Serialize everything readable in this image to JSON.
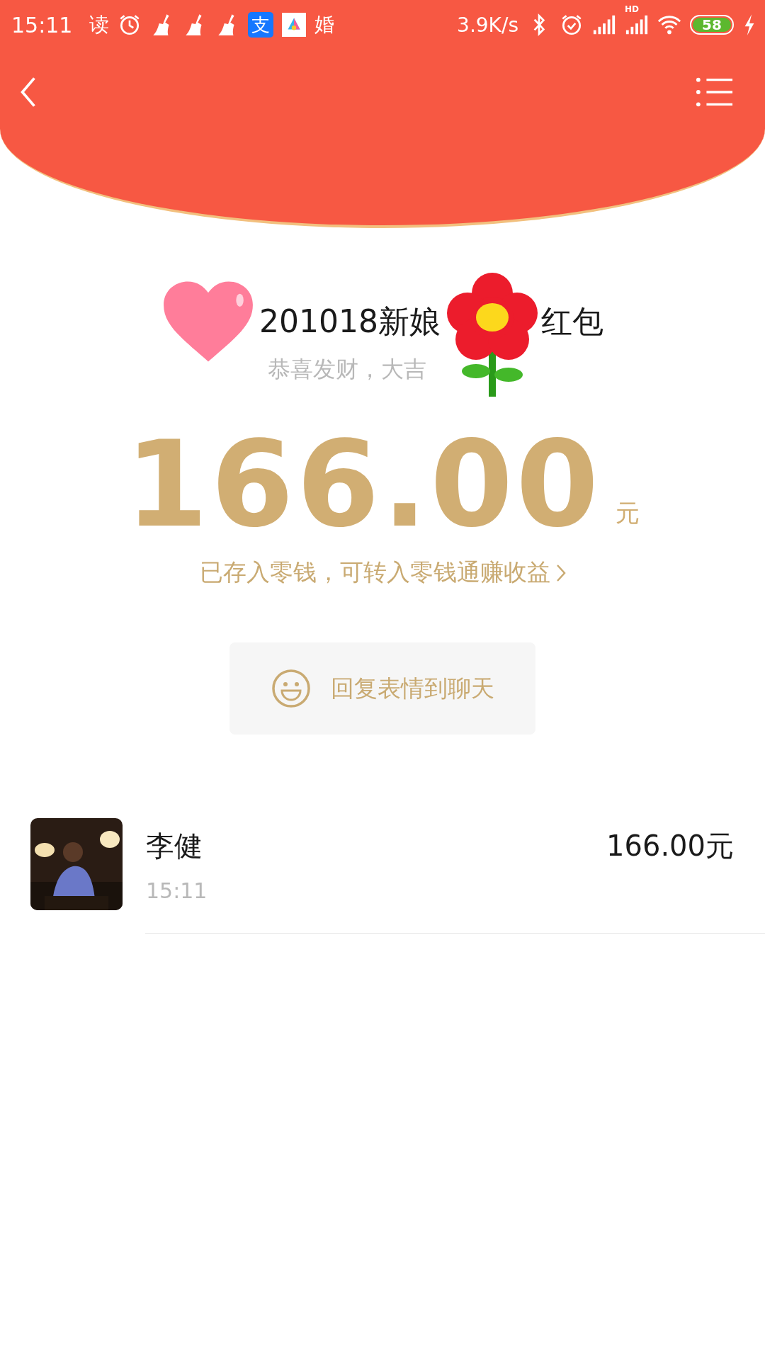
{
  "status_bar": {
    "time": "15:11",
    "notifications": [
      {
        "kind": "text",
        "label": "读"
      },
      {
        "kind": "alarm"
      },
      {
        "kind": "broom"
      },
      {
        "kind": "broom"
      },
      {
        "kind": "broom"
      },
      {
        "kind": "pay",
        "label": "支"
      },
      {
        "kind": "app"
      },
      {
        "kind": "text",
        "label": "婚"
      }
    ],
    "net_speed": "3.9K/s",
    "hd_label": "HD",
    "battery": "58"
  },
  "title_parts": [
    "201018新娘",
    "红包"
  ],
  "subtitle": "恭喜发财，大吉",
  "amount": "166.00",
  "unit": "元",
  "note_link": "已存入零钱，可转入零钱通赚收益",
  "reply_button": "回复表情到聊天",
  "records": [
    {
      "name": "李健",
      "time": "15:11",
      "amount": "166.00元"
    }
  ]
}
